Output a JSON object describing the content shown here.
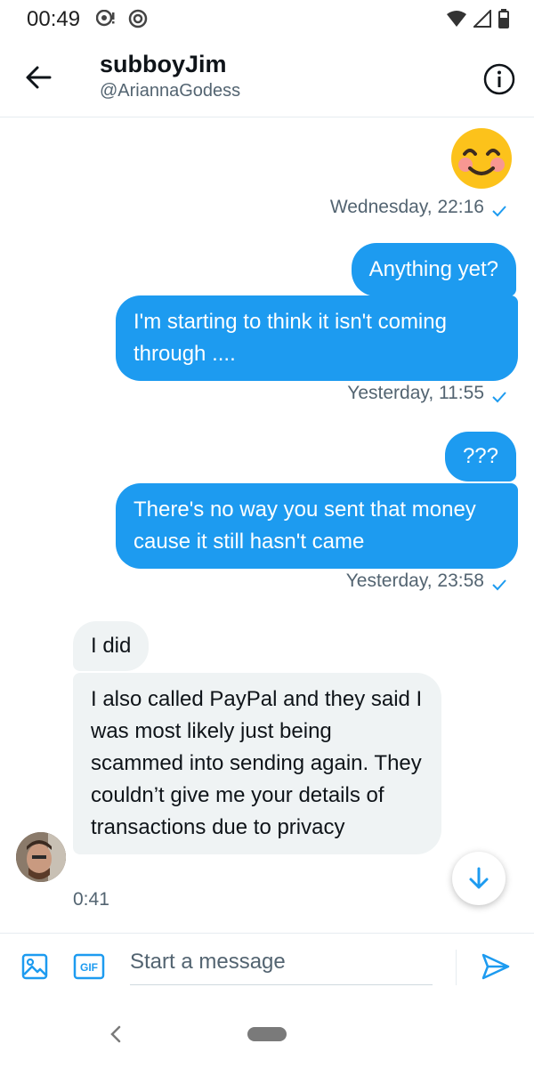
{
  "status_bar": {
    "time": "00:49",
    "icons_left": [
      "chat-notification-icon",
      "vpn-icon"
    ],
    "icons_right": [
      "wifi-icon",
      "signal-icon",
      "battery-icon"
    ]
  },
  "header": {
    "title": "subboyJim",
    "handle": "@AriannaGodess",
    "back_icon": "arrow-left-icon",
    "info_icon": "info-circle-icon"
  },
  "messages": {
    "emoji": "smiling-face-with-blush-emoji",
    "ts1": "Wednesday, 22:16",
    "out1": "Anything yet?",
    "out2": "I'm starting to think it isn't coming through ....",
    "ts2": "Yesterday, 11:55",
    "out3": "???",
    "out4": "There's no way you sent that money cause it still hasn't came",
    "ts3": "Yesterday, 23:58",
    "in1": "I did",
    "in2": "I also called PayPal and they said I was most likely just being scammed into sending again. They couldn’t give me your details of transactions due to privacy",
    "in_time": "0:41"
  },
  "composer": {
    "placeholder": "Start a message",
    "icons": [
      "image-icon",
      "gif-icon",
      "send-icon"
    ]
  },
  "colors": {
    "accent": "#1d9bf0",
    "incoming_bubble": "#eff3f4",
    "secondary_text": "#536471"
  }
}
